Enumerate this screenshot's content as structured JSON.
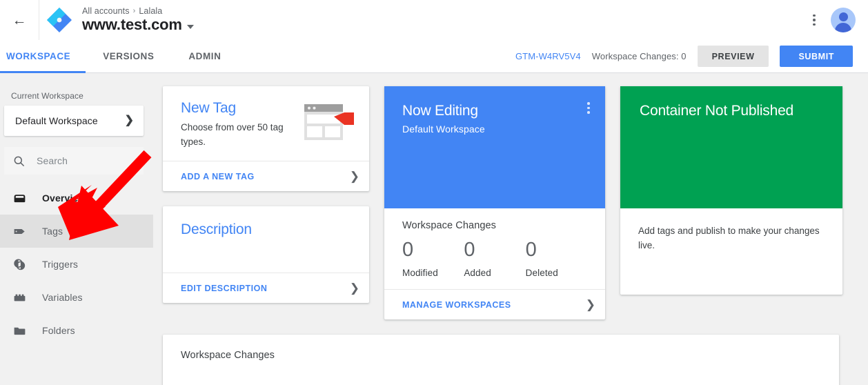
{
  "topbar": {
    "back_label": "←",
    "logo_name": "google-tag-manager-logo",
    "breadcrumb_account": "All accounts",
    "breadcrumb_separator": "›",
    "breadcrumb_container": "Lalala",
    "container_name": "www.test.com",
    "more_menu_label": "⋮",
    "avatar_label": "account"
  },
  "tabs": [
    {
      "label": "WORKSPACE",
      "active": true
    },
    {
      "label": "VERSIONS",
      "active": false
    },
    {
      "label": "ADMIN",
      "active": false
    }
  ],
  "tabbar_right": {
    "gtm_id": "GTM-W4RV5V4",
    "workspace_changes": "Workspace Changes: 0",
    "preview_label": "PREVIEW",
    "submit_label": "SUBMIT"
  },
  "sidebar": {
    "section_label": "Current Workspace",
    "workspace_name": "Default Workspace",
    "workspace_chevron": "❯",
    "search_placeholder": "Search",
    "items": [
      {
        "label": "Overview",
        "icon": "inbox-icon",
        "current": true,
        "highlighted": false
      },
      {
        "label": "Tags",
        "icon": "tag-icon",
        "current": false,
        "highlighted": true
      },
      {
        "label": "Triggers",
        "icon": "trigger-icon",
        "current": false,
        "highlighted": false
      },
      {
        "label": "Variables",
        "icon": "variable-icon",
        "current": false,
        "highlighted": false
      },
      {
        "label": "Folders",
        "icon": "folder-icon",
        "current": false,
        "highlighted": false
      }
    ]
  },
  "new_tag_card": {
    "title": "New Tag",
    "description": "Choose from over 50 tag types.",
    "footer_link": "ADD A NEW TAG",
    "chevron": "❯",
    "illustration": "browser-window-with-tag-illustration"
  },
  "description_card": {
    "title": "Description",
    "footer_link": "EDIT DESCRIPTION",
    "chevron": "❯"
  },
  "now_editing_card": {
    "title": "Now Editing",
    "subtitle": "Default Workspace",
    "menu_label": "⋮",
    "stats_title": "Workspace Changes",
    "stats": [
      {
        "value": "0",
        "label": "Modified"
      },
      {
        "value": "0",
        "label": "Added"
      },
      {
        "value": "0",
        "label": "Deleted"
      }
    ],
    "footer_link": "MANAGE WORKSPACES",
    "chevron": "❯"
  },
  "published_card": {
    "title": "Container Not Published",
    "body": "Add tags and publish to make your changes live."
  },
  "bottom_panel": {
    "title": "Workspace Changes"
  },
  "annotation": {
    "type": "red-arrow",
    "points_to": "Tags",
    "color": "#FF0000"
  },
  "colors": {
    "google_blue": "#4285F4",
    "google_green": "#00A152",
    "annotation_red": "#FF0000",
    "page_background": "#F1F1F1",
    "text_primary": "#202124",
    "text_secondary": "#5F6368"
  }
}
